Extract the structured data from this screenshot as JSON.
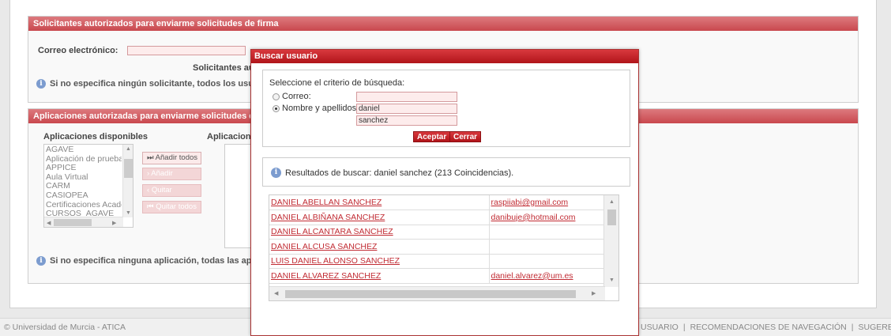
{
  "section_signers": {
    "title": "Solicitantes autorizados para enviarme solicitudes de firma",
    "email_label": "Correo electrónico:",
    "list_title": "Solicitantes aut",
    "info": "Si no especifica ningún solicitante, todos los usuario"
  },
  "section_apps": {
    "title": "Aplicaciones autorizadas para enviarme solicitudes de fir",
    "available_label": "Aplicaciones disponibles",
    "authorized_label": "Aplicacion",
    "available_items": [
      "AGAVE",
      "Aplicación de prueba",
      "APPICE",
      "Aula Virtual",
      "CARM",
      "CASIOPEA",
      "Certificaciones Académicas",
      "CURSOS_AGAVE"
    ],
    "add_all": "Añadir todos",
    "add": "Añadir",
    "remove": "Quitar",
    "remove_all": "Quitar todos",
    "info": "Si no especifica ninguna aplicación, todas las aplica"
  },
  "footer": {
    "copyright": "© Universidad de Murcia - ATICA",
    "links": [
      "USUARIO",
      "RECOMENDACIONES DE NAVEGACIÓN",
      "SUGERENCIAS"
    ],
    "separator": "|"
  },
  "modal": {
    "title": "Buscar usuario",
    "criteria_title": "Seleccione el criterio de búsqueda:",
    "email_option": "Correo:",
    "name_option": "Nombre y apellidos:",
    "email_value": "",
    "first_name_value": "daniel",
    "last_name_value": "sanchez",
    "accept": "Aceptar",
    "close": "Cerrar",
    "result_text": "Resultados de buscar: daniel sanchez (213 Coincidencias).",
    "results": [
      {
        "name": "DANIEL ABELLAN SANCHEZ",
        "email": "raspiiabi@gmail.com"
      },
      {
        "name": "DANIEL ALBIÑANA SANCHEZ",
        "email": "danibuje@hotmail.com"
      },
      {
        "name": "DANIEL ALCANTARA SANCHEZ",
        "email": ""
      },
      {
        "name": "DANIEL ALCUSA SANCHEZ",
        "email": ""
      },
      {
        "name": "LUIS DANIEL ALONSO SANCHEZ",
        "email": ""
      },
      {
        "name": "DANIEL ALVAREZ SANCHEZ",
        "email": "daniel.alvarez@um.es"
      }
    ]
  }
}
